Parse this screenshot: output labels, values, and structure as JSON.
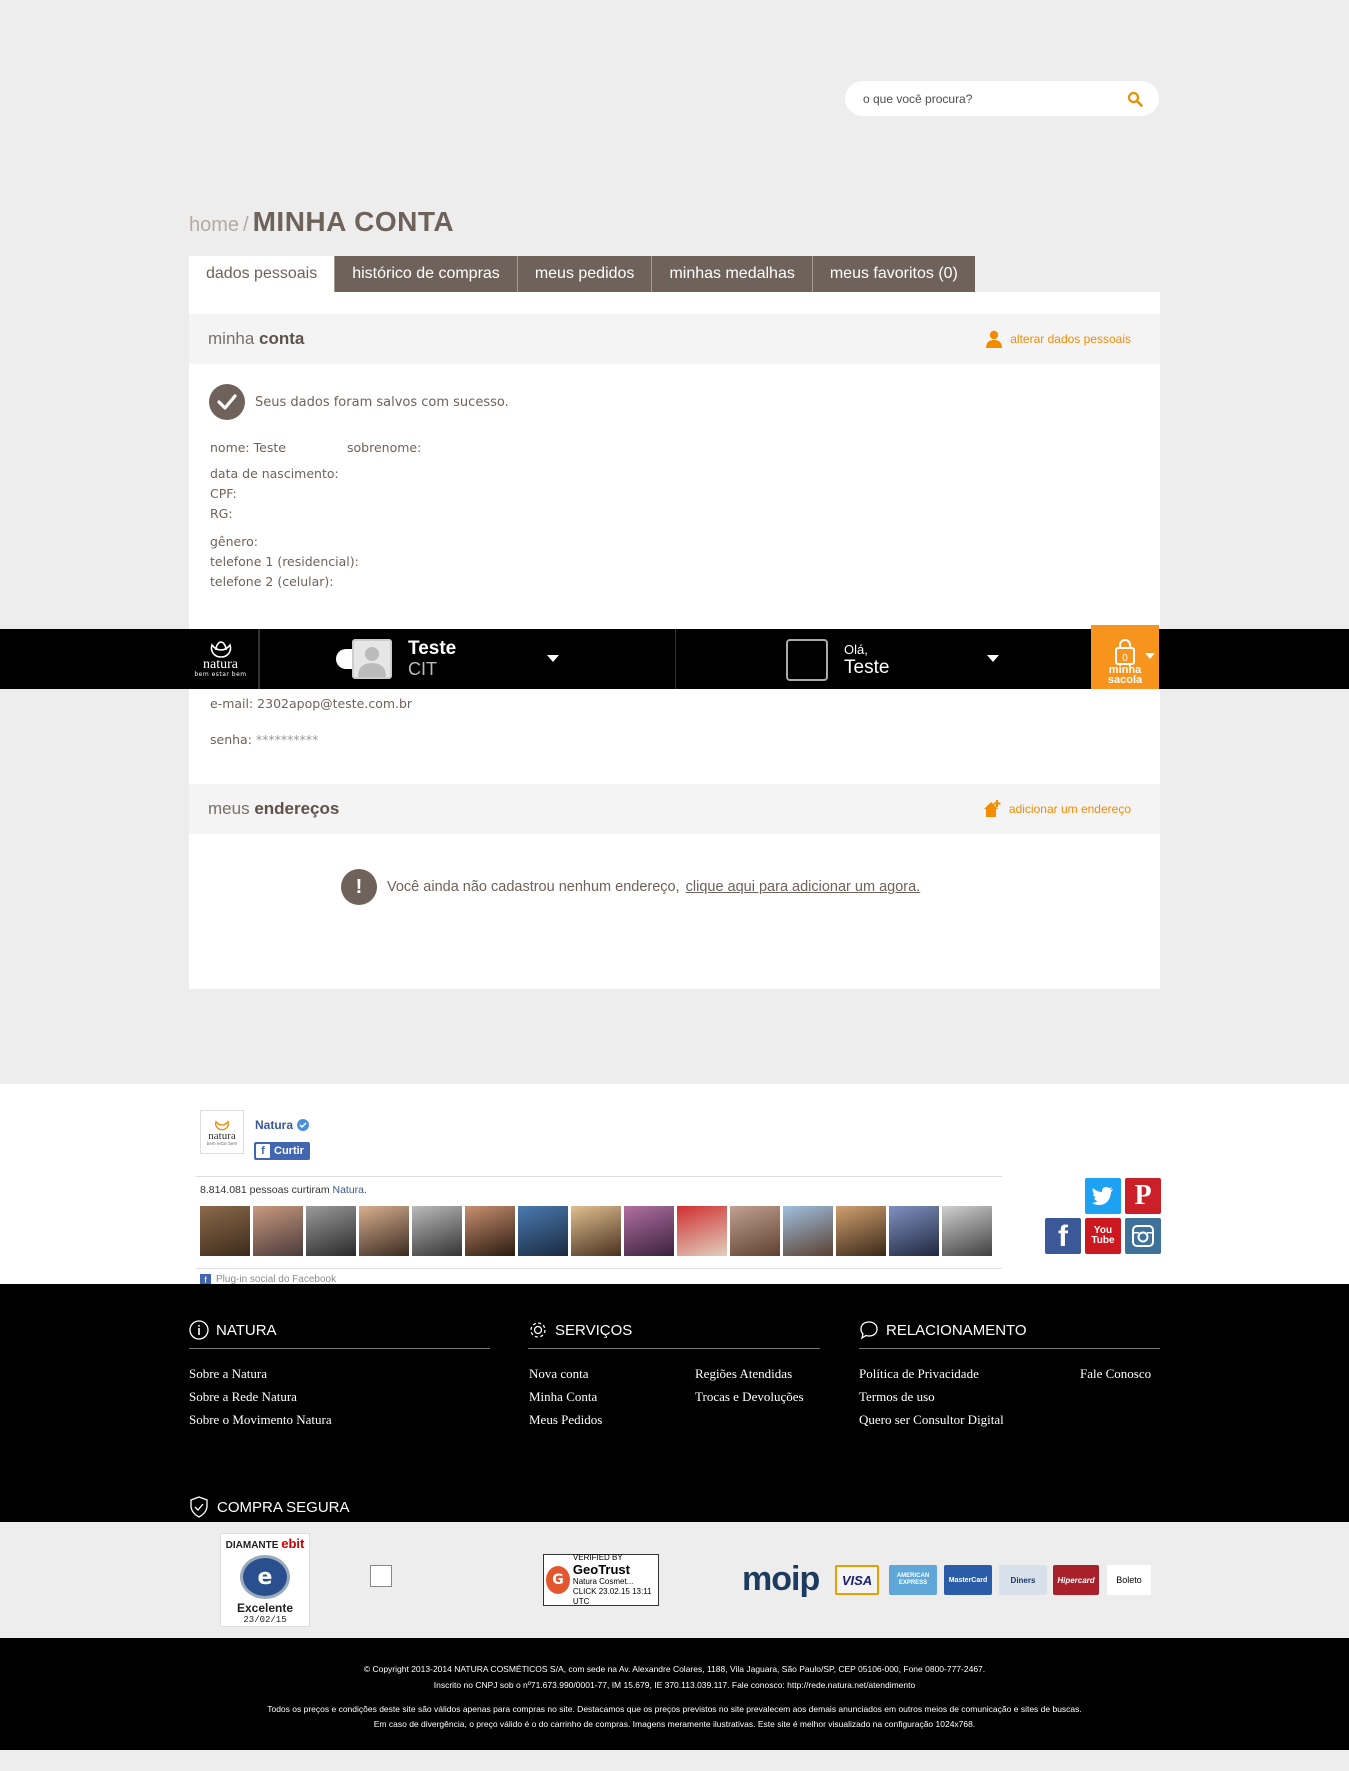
{
  "search": {
    "placeholder": "o que você procura?"
  },
  "breadcrumb": {
    "home": "home",
    "separator": "/",
    "title": "MINHA CONTA"
  },
  "tabs": [
    {
      "label": "dados pessoais",
      "active": true
    },
    {
      "label": "histórico de compras",
      "active": false
    },
    {
      "label": "meus pedidos",
      "active": false
    },
    {
      "label": "minhas medalhas",
      "active": false
    },
    {
      "label": "meus favoritos (0)",
      "active": false
    }
  ],
  "account": {
    "head_light": "minha",
    "head_bold": "conta",
    "edit_link": "alterar dados pessoais",
    "success": "Seus dados foram salvos com sucesso.",
    "nome": "nome: Teste",
    "sobrenome": "sobrenome:",
    "nascimento": "data de nascimento:",
    "cpf": "CPF:",
    "rg": "RG:",
    "genero": "gênero:",
    "tel1": "telefone 1 (residencial):",
    "tel2": "telefone 2 (celular):",
    "email": "e-mail: 2302apop@teste.com.br",
    "senha_label": "senha:",
    "senha_value": "**********"
  },
  "addresses": {
    "head_light": "meus",
    "head_bold": "endereços",
    "add_link": "adicionar um endereço",
    "empty_text": "Você ainda não cadastrou nenhum endereço,",
    "empty_link": "clique aqui para adicionar um agora."
  },
  "topbar": {
    "logo_text": "natura",
    "logo_sub": "bem estar bem",
    "consultant_name": "Teste",
    "consultant_code": "CIT",
    "greeting": "Olá,",
    "user_name": "Teste",
    "bag_count": "0",
    "bag_label1": "minha",
    "bag_label2": "sacola"
  },
  "facebook": {
    "page_name": "Natura",
    "logo_text": "natura",
    "logo_sub": "bem estar bem",
    "like_label": "Curtir",
    "likes_count": "8.814.081 pessoas curtiram",
    "likes_page": "Natura.",
    "plugin_label": "Plug-in social do Facebook"
  },
  "social": [
    {
      "name": "twitter-icon",
      "label": "t",
      "color": "#1da1f2"
    },
    {
      "name": "pinterest-icon",
      "label": "P",
      "color": "#cb2027"
    },
    {
      "name": "facebook-icon",
      "label": "f",
      "color": "#3b5998"
    },
    {
      "name": "youtube-icon",
      "label": "You Tube",
      "color": "#cc181e"
    },
    {
      "name": "instagram-icon",
      "label": "◎",
      "color": "#3f729b"
    }
  ],
  "footer": {
    "col1_title": "NATURA",
    "col1_links": [
      "Sobre a Natura",
      "Sobre a Rede Natura",
      "Sobre o Movimento Natura"
    ],
    "col2_title": "SERVIÇOS",
    "col2_links_a": [
      "Nova conta",
      "Minha Conta",
      "Meus Pedidos"
    ],
    "col2_links_b": [
      "Regiões Atendidas",
      "Trocas e Devoluções"
    ],
    "col3_title": "RELACIONAMENTO",
    "col3_links_a": [
      "Política de Privacidade",
      "Termos de uso",
      "Quero ser Consultor Digital"
    ],
    "col3_links_b": [
      "Fale Conosco"
    ],
    "secure_title": "COMPRA SEGURA"
  },
  "seals": {
    "ebit_top": "DIAMANTE",
    "ebit_brand": "ebit",
    "ebit_level": "Excelente",
    "ebit_date": "23/02/15",
    "geo_verified": "VERIFIED BY",
    "geo_brand": "GeoTrust",
    "geo_name": "Natura Cosmet...",
    "geo_click": "CLICK 23.02.15 13:11 UTC",
    "moip": "moip",
    "cards": [
      "VISA",
      "AMERICAN EXPRESS",
      "MasterCard",
      "Diners",
      "Hipercard",
      "Boleto"
    ]
  },
  "copyright": {
    "line1": "© Copyright 2013-2014 NATURA COSMÉTICOS S/A, com sede na Av. Alexandre Colares, 1188, Vila Jaguara, São Paulo/SP, CEP 05106-000, Fone 0800-777-2467.",
    "line2": "Inscrito no CNPJ sob o nº71.673.990/0001-77, IM 15.679, IE 370.113.039.117. Fale conosco: http://rede.natura.net/atendimento",
    "line3": "Todos os preços e condições deste site são válidos apenas para compras no site. Destacamos que os preços previstos no site prevalecem aos demais anunciados em outros meios de comunicação e sites de buscas.",
    "line4": "Em caso de divergência, o preço válido é o do carrinho de compras. Imagens meramente ilustrativas. Este site é melhor visualizado na configuração 1024x768."
  },
  "colors": {
    "brand_brown": "#6f625a",
    "accent_orange": "#f28c00",
    "bag_orange": "#f7941d"
  }
}
